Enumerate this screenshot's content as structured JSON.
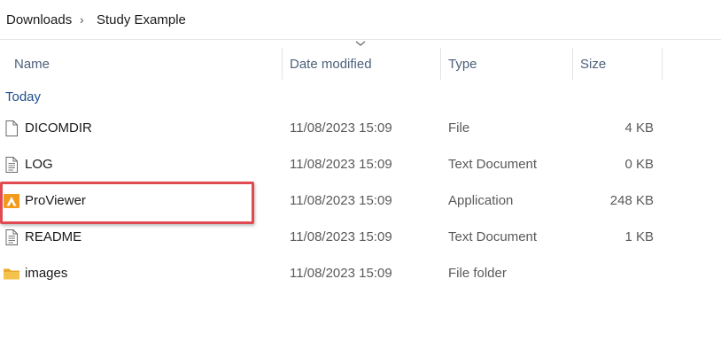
{
  "breadcrumb": {
    "items": [
      "Downloads",
      "Study Example"
    ],
    "separator": "›"
  },
  "columns": {
    "name": "Name",
    "date_modified": "Date modified",
    "type": "Type",
    "size": "Size",
    "sorted_column": "date_modified"
  },
  "group": {
    "label": "Today"
  },
  "files": [
    {
      "name": "DICOMDIR",
      "date": "11/08/2023 15:09",
      "type": "File",
      "size": "4 KB",
      "icon": "blank-file-icon"
    },
    {
      "name": "LOG",
      "date": "11/08/2023 15:09",
      "type": "Text Document",
      "size": "0 KB",
      "icon": "text-document-icon"
    },
    {
      "name": "ProViewer",
      "date": "11/08/2023 15:09",
      "type": "Application",
      "size": "248 KB",
      "icon": "proviewer-app-icon"
    },
    {
      "name": "README",
      "date": "11/08/2023 15:09",
      "type": "Text Document",
      "size": "1 KB",
      "icon": "text-document-icon"
    },
    {
      "name": "images",
      "date": "11/08/2023 15:09",
      "type": "File folder",
      "size": "",
      "icon": "folder-icon"
    }
  ],
  "highlight": {
    "target": "ProViewer",
    "color": "#e24a51"
  },
  "colors": {
    "header_text": "#4c607a",
    "group_text": "#1f4e8c",
    "folder": "#f5c24c",
    "app_icon": "#f39a1d"
  }
}
